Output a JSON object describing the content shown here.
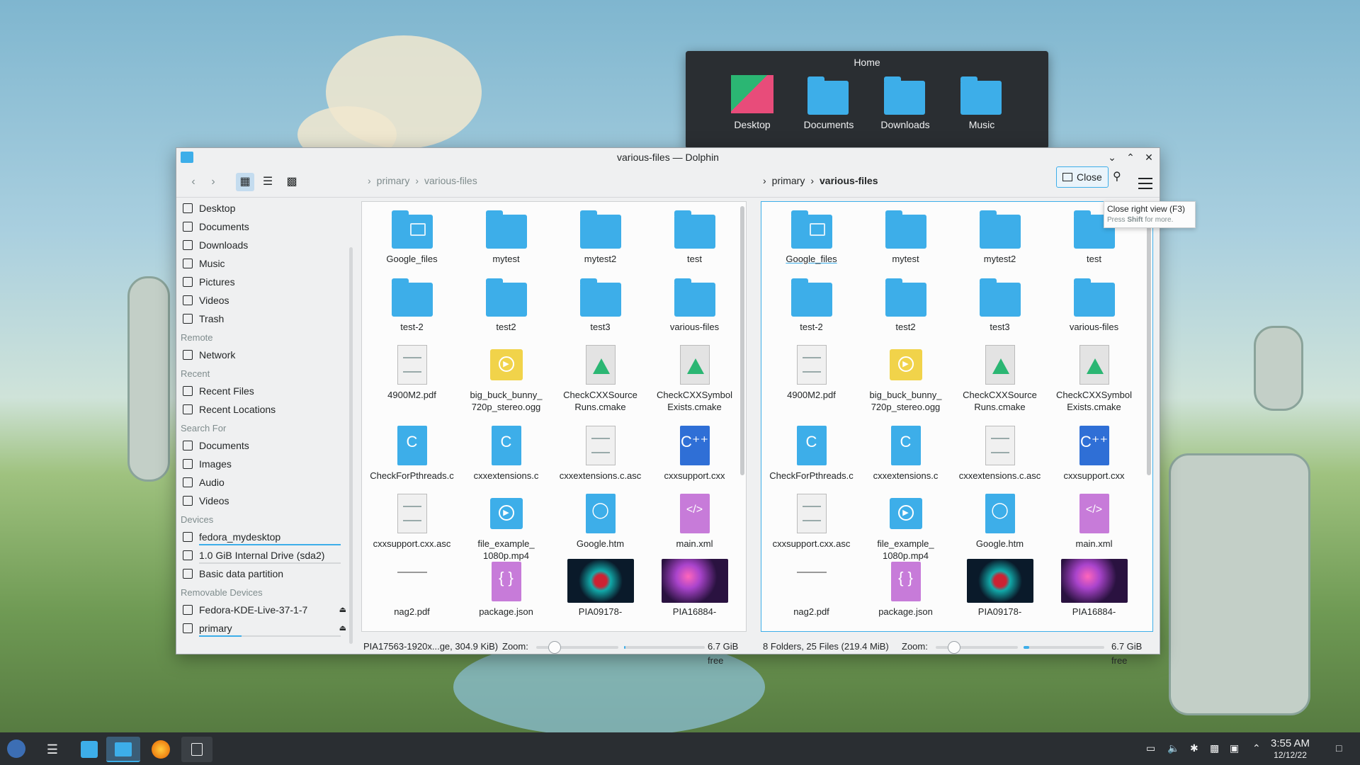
{
  "places_popup": {
    "title": "Home",
    "items": [
      {
        "label": "Desktop"
      },
      {
        "label": "Documents"
      },
      {
        "label": "Downloads"
      },
      {
        "label": "Music"
      }
    ]
  },
  "window": {
    "title": "various-files — Dolphin",
    "left_breadcrumb": [
      "primary",
      "various-files"
    ],
    "right_breadcrumb": [
      "primary",
      "various-files"
    ],
    "close_label": "Close",
    "tooltip": {
      "title": "Close right view (F3)",
      "hint_pre": "Press ",
      "hint_key": "Shift",
      "hint_post": " for more."
    }
  },
  "sidebar": {
    "places": [
      {
        "label": "Desktop",
        "icon": "desktop-icon"
      },
      {
        "label": "Documents",
        "icon": "documents-icon"
      },
      {
        "label": "Downloads",
        "icon": "downloads-icon"
      },
      {
        "label": "Music",
        "icon": "music-icon"
      },
      {
        "label": "Pictures",
        "icon": "pictures-icon"
      },
      {
        "label": "Videos",
        "icon": "videos-icon"
      },
      {
        "label": "Trash",
        "icon": "trash-icon"
      }
    ],
    "remote_header": "Remote",
    "remote": [
      {
        "label": "Network",
        "icon": "network-icon"
      }
    ],
    "recent_header": "Recent",
    "recent": [
      {
        "label": "Recent Files",
        "icon": "recent-files-icon"
      },
      {
        "label": "Recent Locations",
        "icon": "recent-locations-icon"
      }
    ],
    "search_header": "Search For",
    "search": [
      {
        "label": "Documents",
        "icon": "documents-icon"
      },
      {
        "label": "Images",
        "icon": "images-icon"
      },
      {
        "label": "Audio",
        "icon": "audio-icon"
      },
      {
        "label": "Videos",
        "icon": "videos-icon"
      }
    ],
    "devices_header": "Devices",
    "devices": [
      {
        "label": "fedora_mydesktop",
        "icon": "drive-icon",
        "usage": 1.0
      },
      {
        "label": "1.0 GiB Internal Drive (sda2)",
        "icon": "drive-icon",
        "usage": 0.0
      },
      {
        "label": "Basic data partition",
        "icon": "partition-icon"
      }
    ],
    "removable_header": "Removable Devices",
    "removable": [
      {
        "label": "Fedora-KDE-Live-37-1-7",
        "icon": "optical-disc-icon"
      },
      {
        "label": "primary",
        "icon": "usb-drive-icon",
        "usage": 0.3
      }
    ]
  },
  "files": [
    {
      "name": "Google_files",
      "kind": "folder-google"
    },
    {
      "name": "mytest",
      "kind": "folder"
    },
    {
      "name": "mytest2",
      "kind": "folder"
    },
    {
      "name": "test",
      "kind": "folder"
    },
    {
      "name": "test-2",
      "kind": "folder"
    },
    {
      "name": "test2",
      "kind": "folder"
    },
    {
      "name": "test3",
      "kind": "folder"
    },
    {
      "name": "various-files",
      "kind": "folder"
    },
    {
      "name": "4900M2.pdf",
      "kind": "pdf"
    },
    {
      "name": "big_buck_bunny_\n720p_stereo.ogg",
      "kind": "ogg"
    },
    {
      "name": "CheckCXXSource\nRuns.cmake",
      "kind": "cmake"
    },
    {
      "name": "CheckCXXSymbol\nExists.cmake",
      "kind": "cmake"
    },
    {
      "name": "CheckForPthreads.c",
      "kind": "c"
    },
    {
      "name": "cxxextensions.c",
      "kind": "c"
    },
    {
      "name": "cxxextensions.c.asc",
      "kind": "text"
    },
    {
      "name": "cxxsupport.cxx",
      "kind": "cpp"
    },
    {
      "name": "cxxsupport.cxx.asc",
      "kind": "text"
    },
    {
      "name": "file_example_\n1080p.mp4",
      "kind": "mp4"
    },
    {
      "name": "Google.htm",
      "kind": "html"
    },
    {
      "name": "main.xml",
      "kind": "xml"
    },
    {
      "name": "nag2.pdf",
      "kind": "blank"
    },
    {
      "name": "package.json",
      "kind": "json"
    },
    {
      "name": "PIA09178-",
      "kind": "image-helix"
    },
    {
      "name": "PIA16884-",
      "kind": "image-nebula"
    }
  ],
  "status_left": {
    "text": "PIA17563-1920x...ge, 304.9 KiB)",
    "zoom_label": "Zoom:",
    "free": "6.7 GiB free",
    "zoom": 0.22
  },
  "status_right": {
    "text": "8 Folders, 25 Files (219.4 MiB)",
    "zoom_label": "Zoom:",
    "free": "6.7 GiB free",
    "zoom": 0.22
  },
  "taskbar": {
    "time": "3:55 AM",
    "date": "12/12/22"
  },
  "colors": {
    "accent": "#3daee9",
    "panel": "#2a2e32",
    "window": "#eff0f1"
  }
}
